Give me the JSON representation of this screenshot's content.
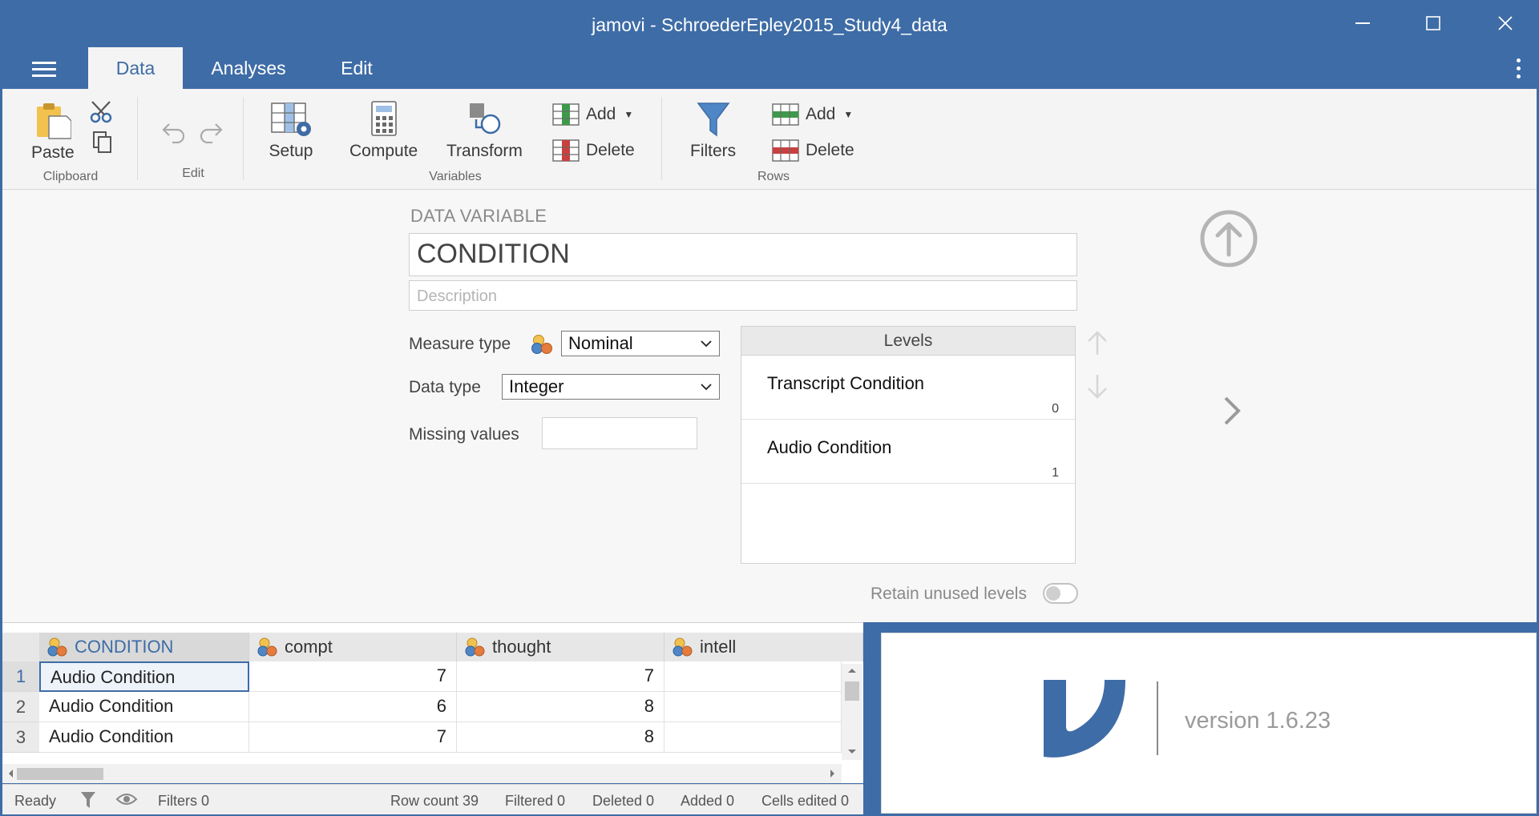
{
  "window": {
    "title": "jamovi - SchroederEpley2015_Study4_data"
  },
  "tabs": [
    {
      "label": "Data"
    },
    {
      "label": "Analyses"
    },
    {
      "label": "Edit"
    }
  ],
  "ribbon": {
    "paste": "Paste",
    "clipboard_group": "Clipboard",
    "edit_group": "Edit",
    "setup": "Setup",
    "compute": "Compute",
    "transform": "Transform",
    "var_add": "Add",
    "var_delete": "Delete",
    "variables_group": "Variables",
    "filters": "Filters",
    "row_add": "Add",
    "row_delete": "Delete",
    "rows_group": "Rows"
  },
  "editor": {
    "section_label": "DATA VARIABLE",
    "name": "CONDITION",
    "description_placeholder": "Description",
    "measure_type_label": "Measure type",
    "measure_type": "Nominal",
    "data_type_label": "Data type",
    "data_type": "Integer",
    "missing_label": "Missing values",
    "levels_header": "Levels",
    "levels": [
      {
        "name": "Transcript Condition",
        "value": "0"
      },
      {
        "name": "Audio Condition",
        "value": "1"
      }
    ],
    "retain_label": "Retain unused levels",
    "retain_on": false
  },
  "grid": {
    "columns": [
      "CONDITION",
      "compt",
      "thought",
      "intell"
    ],
    "rows": [
      {
        "num": "1",
        "cells": [
          "Audio Condition",
          "7",
          "7",
          ""
        ]
      },
      {
        "num": "2",
        "cells": [
          "Audio Condition",
          "6",
          "8",
          ""
        ]
      },
      {
        "num": "3",
        "cells": [
          "Audio Condition",
          "7",
          "8",
          ""
        ]
      }
    ]
  },
  "status": {
    "ready": "Ready",
    "filters": "Filters 0",
    "row_count": "Row count 39",
    "filtered": "Filtered 0",
    "deleted": "Deleted 0",
    "added": "Added 0",
    "cells_edited": "Cells edited 0"
  },
  "results": {
    "version": "version 1.6.23"
  },
  "colors": {
    "accent": "#3e6ca6",
    "nominal_red": "#e57b3c",
    "nominal_blue": "#4f86c6",
    "nominal_yellow": "#f2c14e"
  }
}
